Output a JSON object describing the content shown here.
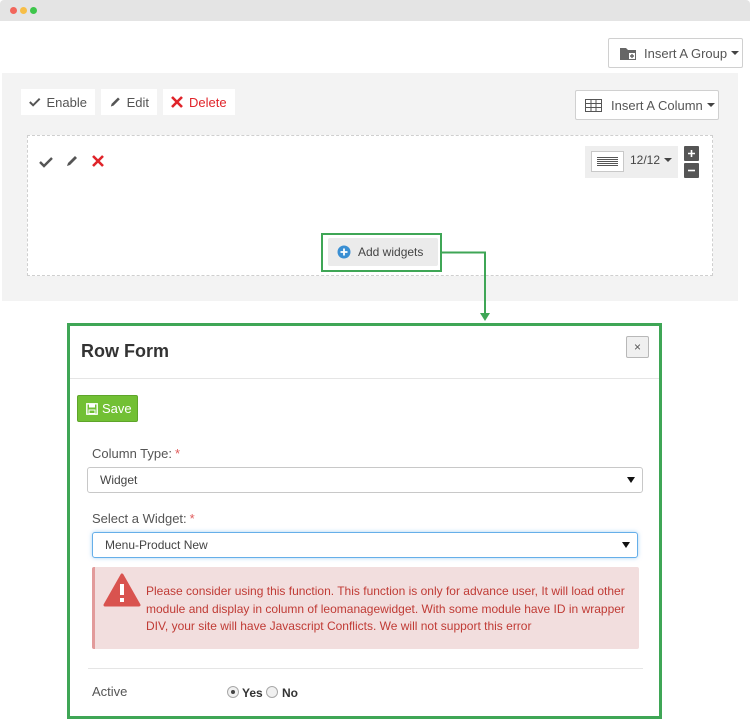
{
  "toolbar": {
    "insert_group_label": "Insert A Group",
    "enable_label": "Enable",
    "edit_label": "Edit",
    "delete_label": "Delete",
    "insert_column_label": "Insert A Column"
  },
  "column": {
    "width_label": "12/12",
    "add_widgets_label": "Add widgets"
  },
  "modal": {
    "title": "Row Form",
    "close_glyph": "×",
    "save_label": "Save",
    "column_type_label": "Column Type:",
    "column_type_value": "Widget",
    "select_widget_label": "Select a Widget:",
    "select_widget_value": "Menu-Product New",
    "required_mark": "*",
    "alert_text": "Please consider using this function. This function is only for advance user, It will load other module and display in column of leomanagewidget. With some module have ID in wrapper DIV, your site will have Javascript Conflicts. We will not support this error",
    "active_label": "Active",
    "yes_label": "Yes",
    "no_label": "No",
    "active_selected": "Yes"
  },
  "colors": {
    "highlight_green": "#3fa656",
    "save_green": "#72c034",
    "delete_red": "#e0242a",
    "alert_bg": "#f2dede",
    "alert_text": "#c03b35",
    "add_icon_blue": "#3a8fd3"
  },
  "icons": [
    "check-icon",
    "pencil-icon",
    "times-icon",
    "table-icon",
    "folder-plus-icon",
    "plus-circle-icon",
    "floppy-icon",
    "warning-icon",
    "lines-icon",
    "plus-icon",
    "minus-icon"
  ]
}
